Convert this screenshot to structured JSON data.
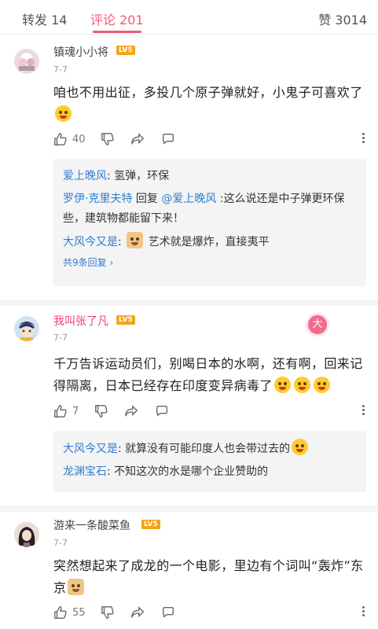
{
  "tabs": {
    "forward": "转发 14",
    "comments": "评论 201",
    "likes": "赞 3014"
  },
  "comments": [
    {
      "username": "镇魂小小将",
      "level": "LV5",
      "date": "7-7",
      "text": "咱也不用出征，多投几个原子弹就好，小鬼子可喜欢了",
      "likes": "40",
      "replies": [
        {
          "name": "爱上晚风",
          "sep": ": ",
          "text": "氢弹，环保"
        },
        {
          "name": "罗伊·克里夫特",
          "mid": " 回复 ",
          "target": "@爱上晚风",
          "sep": " :",
          "text": "这么说还是中子弹更环保些，建筑物都能留下来！"
        },
        {
          "name": "大风今又是",
          "sep": ": ",
          "text": "艺术就是爆炸，直接夷平"
        }
      ],
      "reply_count": "共9条回复 ›"
    },
    {
      "username": "我叫张了凡",
      "level": "LV5",
      "date": "7-7",
      "text": "千万告诉运动员们，别喝日本的水啊，还有啊，回来记得隔离，日本已经存在印度变异病毒了",
      "likes": "7",
      "badge": "大",
      "replies": [
        {
          "name": "大风今又是",
          "sep": ": ",
          "text": "就算没有可能印度人也会带过去的"
        },
        {
          "name": "龙渊宝石",
          "sep": ": ",
          "text": "不知这次的水是哪个企业赞助的"
        }
      ]
    },
    {
      "username": "游来一条酸菜鱼",
      "level": "LV5",
      "date": "7-7",
      "text": "突然想起来了成龙的一个电影，里边有个词叫“轰炸”东京",
      "likes": "55"
    }
  ]
}
